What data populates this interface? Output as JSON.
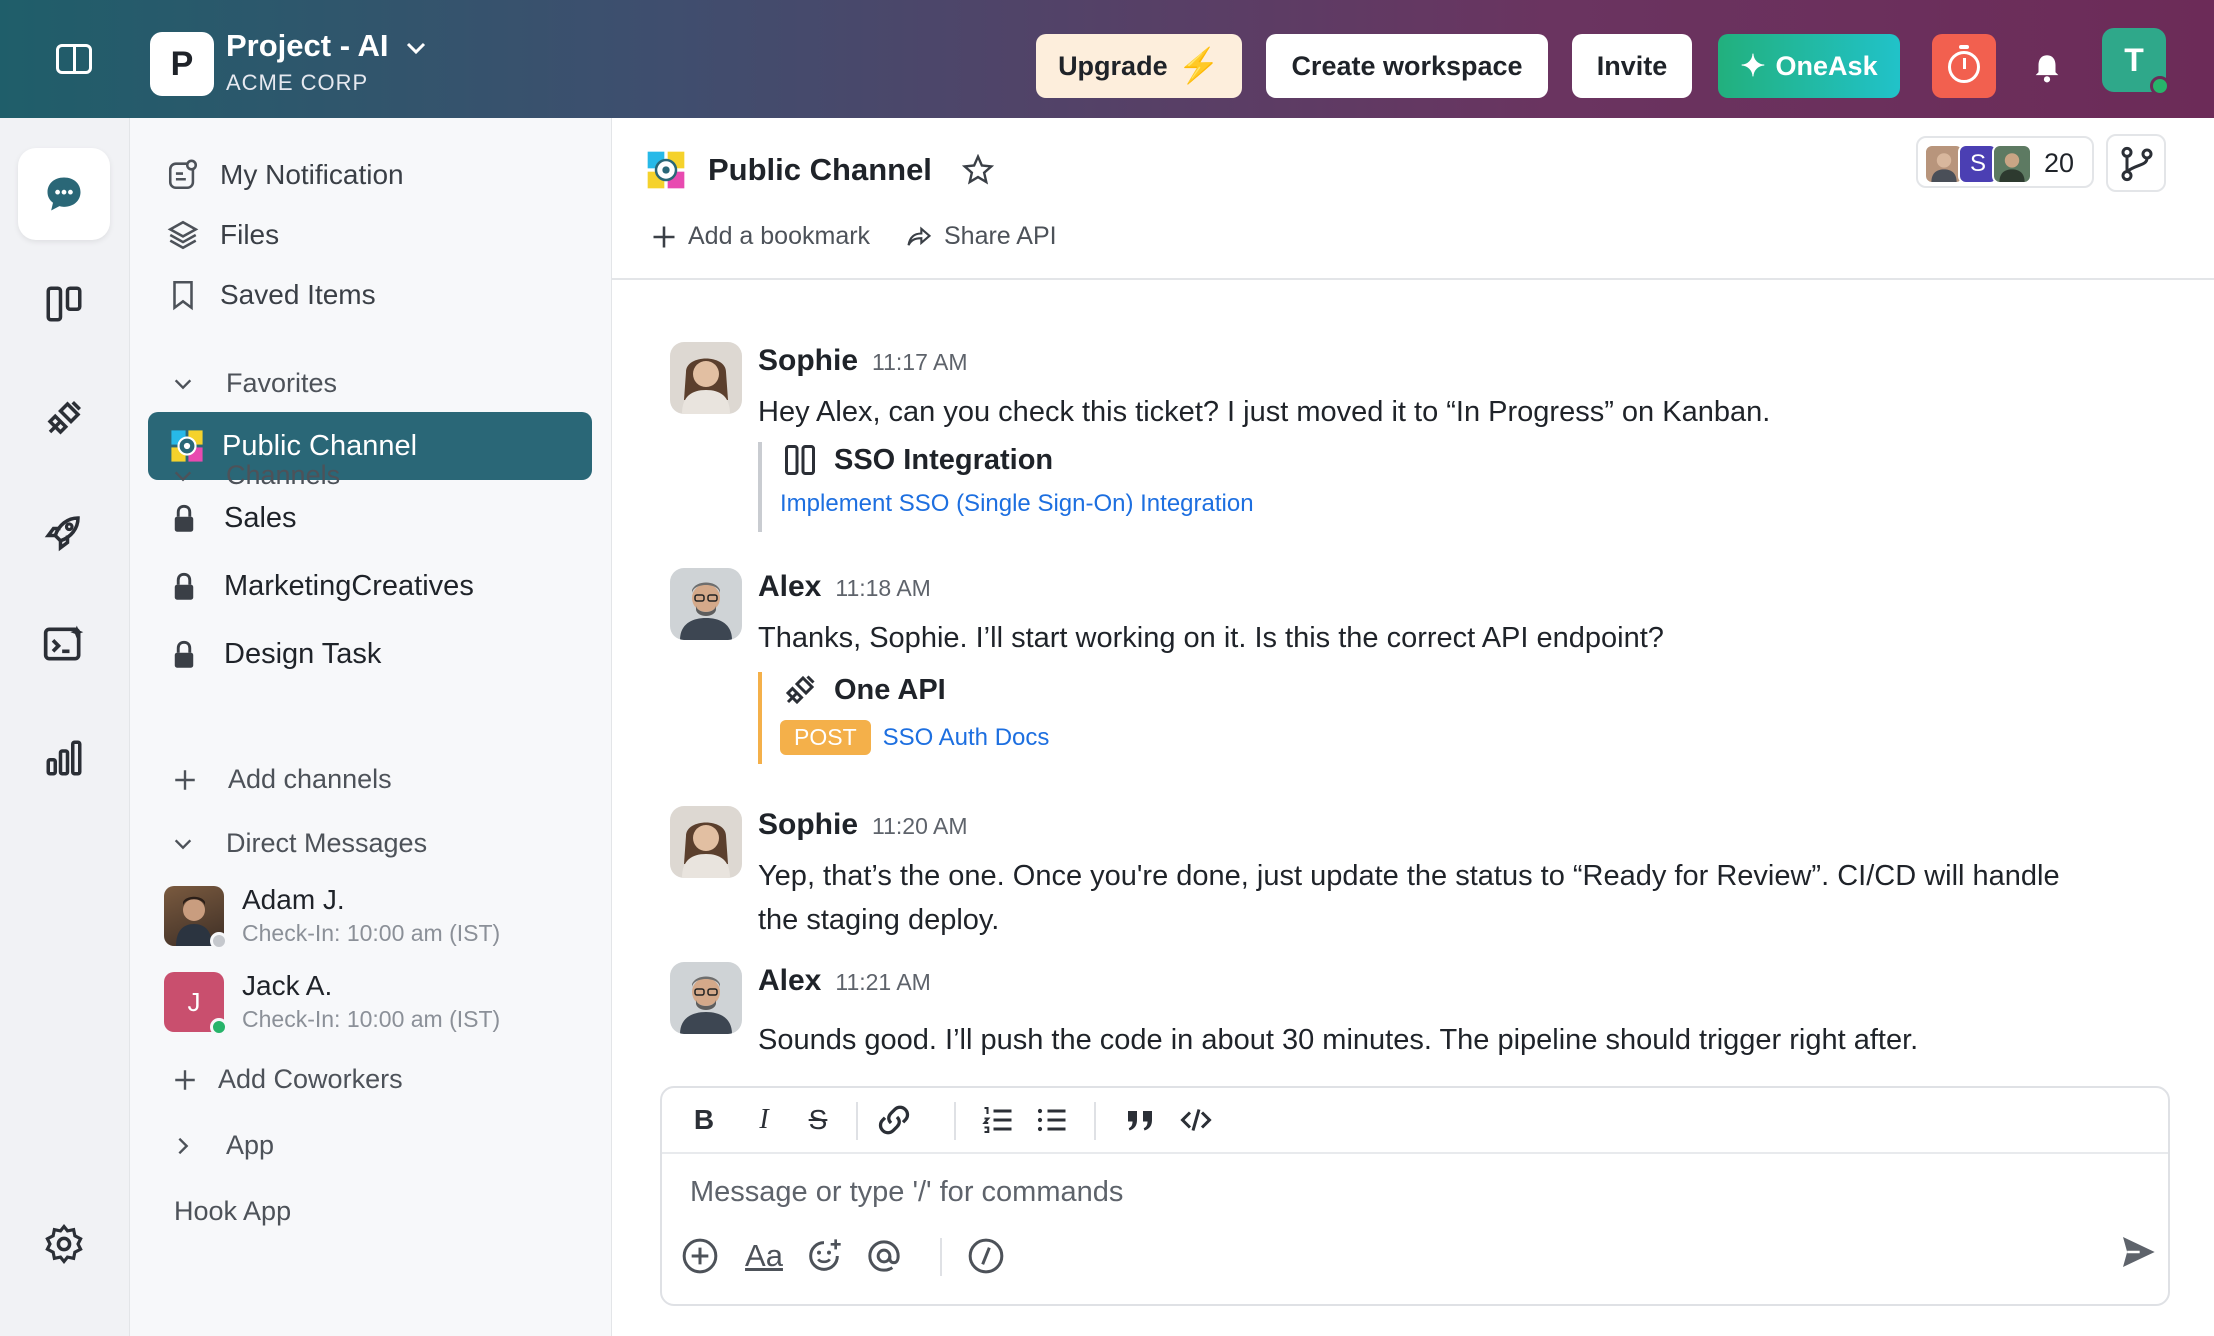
{
  "topbar": {
    "project_logo_letter": "P",
    "project_name": "Project - AI",
    "org_name": "ACME CORP",
    "upgrade_label": "Upgrade",
    "create_workspace_label": "Create workspace",
    "invite_label": "Invite",
    "oneask_label": "OneAsk",
    "user_avatar_letter": "T"
  },
  "sidebar": {
    "top_items": [
      {
        "label": "My Notification",
        "icon": "notification-icon"
      },
      {
        "label": "Files",
        "icon": "layers-icon"
      },
      {
        "label": "Saved Items",
        "icon": "bookmark-icon"
      }
    ],
    "favorites_label": "Favorites",
    "active_channel": "Public Channel",
    "channels_label": "Channels",
    "channels": [
      "Sales",
      "MarketingCreatives",
      "Design Task"
    ],
    "add_channels_label": "Add channels",
    "direct_messages_label": "Direct Messages",
    "dms": [
      {
        "name": "Adam J.",
        "status": "Check-In: 10:00 am (IST)"
      },
      {
        "name": "Jack A.",
        "status": "Check-In: 10:00 am (IST)",
        "initial": "J"
      }
    ],
    "add_coworkers_label": "Add Coworkers",
    "app_label": "App",
    "hook_app_label": "Hook App"
  },
  "channel": {
    "title": "Public Channel",
    "add_bookmark_label": "Add a bookmark",
    "share_api_label": "Share API",
    "member_initial": "S",
    "member_count": "20"
  },
  "messages": [
    {
      "author": "Sophie",
      "time": "11:17 AM",
      "text": "Hey Alex, can you check this ticket? I just moved it to “In Progress” on Kanban.",
      "card": {
        "title": "SSO Integration",
        "link": "Implement SSO (Single Sign-On) Integration"
      }
    },
    {
      "author": "Alex",
      "time": "11:18 AM",
      "text": "Thanks, Sophie. I’ll start working on it. Is this the correct API endpoint?",
      "card": {
        "title": "One API",
        "method": "POST",
        "link": "SSO Auth Docs"
      }
    },
    {
      "author": "Sophie",
      "time": "11:20 AM",
      "text": "Yep, that’s the one. Once you're done, just update the status to “Ready for Review”. CI/CD will handle the staging deploy."
    },
    {
      "author": "Alex",
      "time": "11:21 AM",
      "text": "Sounds good. I’ll push the code in about 30 minutes. The pipeline should trigger right after."
    }
  ],
  "composer": {
    "placeholder": "Message or type '/' for commands",
    "text_format_label": "Aa"
  },
  "colors": {
    "accent": "#2a6777",
    "link": "#1d6fe0",
    "post_badge": "#f4b04a",
    "oneask_green": "#22b07d",
    "timer_red": "#f2604f"
  }
}
